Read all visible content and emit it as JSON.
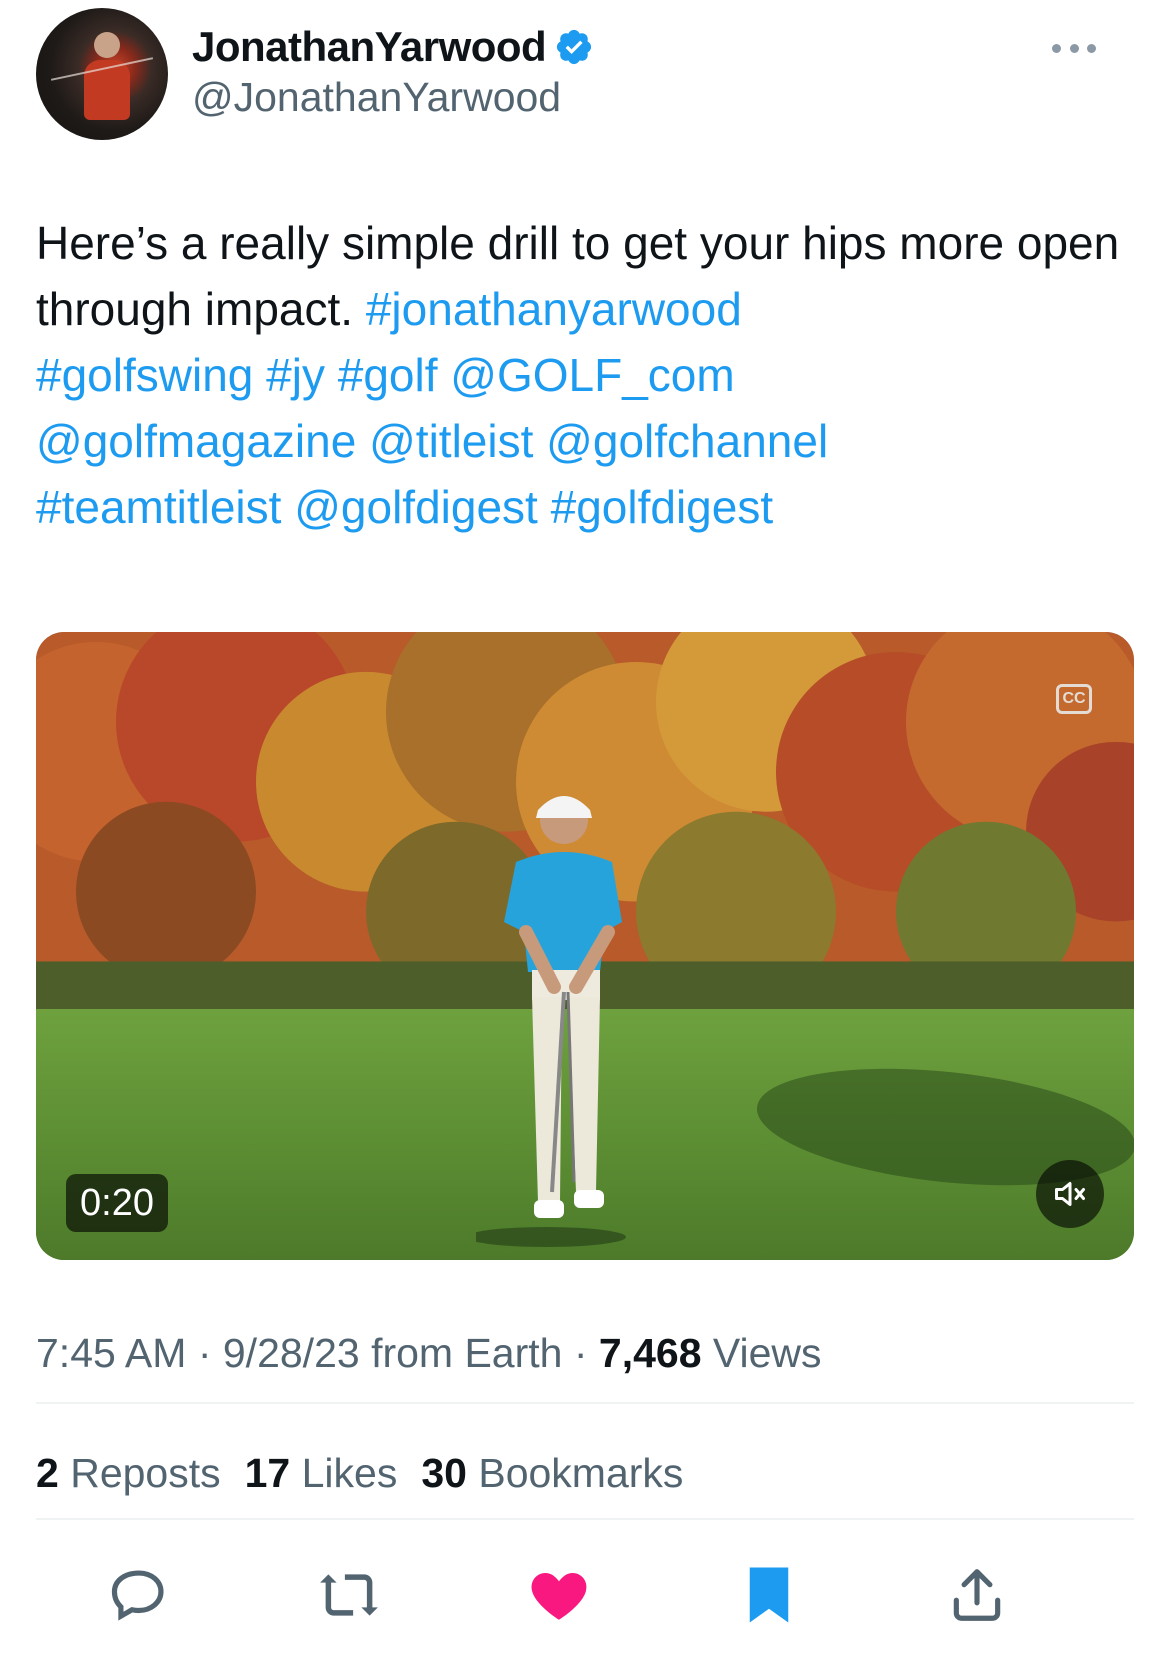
{
  "header": {
    "display_name": "JonathanYarwood",
    "handle": "@JonathanYarwood",
    "verified_icon": "verified-badge-icon",
    "more_icon": "more-options-icon"
  },
  "tweet": {
    "text_plain": "Here’s a really simple drill to get your hips more open through impact. ",
    "tags": [
      "#jonathanyarwood",
      "#golfswing",
      "#jy",
      "#golf",
      "@GOLF_com",
      "@golfmagazine",
      "@titleist",
      "@golfchannel",
      "#teamtitleist",
      "@golfdigest",
      "#golfdigest"
    ]
  },
  "media": {
    "duration": "0:20",
    "cc_label": "CC",
    "cc_icon": "closed-captions-icon",
    "mute_icon": "muted-speaker-icon"
  },
  "meta": {
    "time": "7:45 AM",
    "sep1": " · ",
    "date": "9/28/23",
    "from": " from Earth",
    "sep2": " · ",
    "views_count": "7,468",
    "views_label": " Views"
  },
  "stats": {
    "reposts_count": "2",
    "reposts_label": " Reposts",
    "likes_count": "17",
    "likes_label": " Likes",
    "bookmarks_count": "30",
    "bookmarks_label": " Bookmarks"
  },
  "actions": {
    "reply_icon": "reply-icon",
    "repost_icon": "repost-icon",
    "like_icon": "heart-icon",
    "bookmark_icon": "bookmark-icon",
    "share_icon": "share-icon"
  },
  "colors": {
    "link": "#1d9bf0",
    "like": "#f91880",
    "bookmark": "#1d9bf0",
    "secondary_text": "#536471"
  }
}
